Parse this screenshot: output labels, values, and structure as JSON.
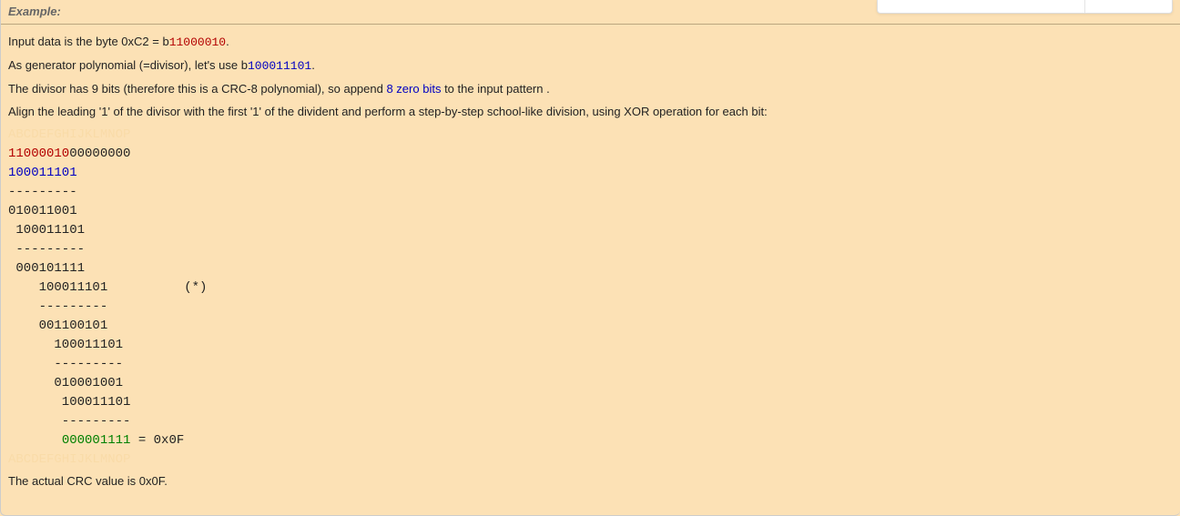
{
  "header": {
    "label": "Example:"
  },
  "intro": {
    "line1_pre": "Input data is the byte 0xC2 = b",
    "line1_bits": "11000010",
    "line1_post": ".",
    "line2_pre": "As generator polynomial (=divisor), let's use b",
    "line2_bits": "100011101",
    "line2_post": ".",
    "line3_pre": "The divisor has 9 bits (therefore this is a CRC-8 polynomial), so append ",
    "line3_zero": "8 zero bits",
    "line3_post": " to the input pattern .",
    "line4": "Align the leading '1' of the divisor with the first '1' of the divident and perform a step-by-step school-like division, using XOR operation for each bit:"
  },
  "calc": {
    "header_letters": "ABCDEFGHIJKLMNOP",
    "r0_data": "11000010",
    "r0_zeros": "00000000",
    "r1_div": "100011101",
    "r2_sep": "---------",
    "r3_res": "010011001",
    "r4_div": " 100011101",
    "r5_sep": " ---------",
    "r6_res": " 000101111",
    "r7_div": "    100011101          (*)",
    "r8_sep": "    ---------",
    "r9_res": "    001100101",
    "r10_div": "      100011101",
    "r11_sep": "      ---------",
    "r12_res": "      010001001",
    "r13_div": "       100011101",
    "r14_sep": "       ---------",
    "r15_pre": "       ",
    "r15_green": "000001111",
    "r15_post": " = 0x0F",
    "footer_letters": "ABCDEFGHIJKLMNOP"
  },
  "footer": "The actual CRC value is 0x0F."
}
